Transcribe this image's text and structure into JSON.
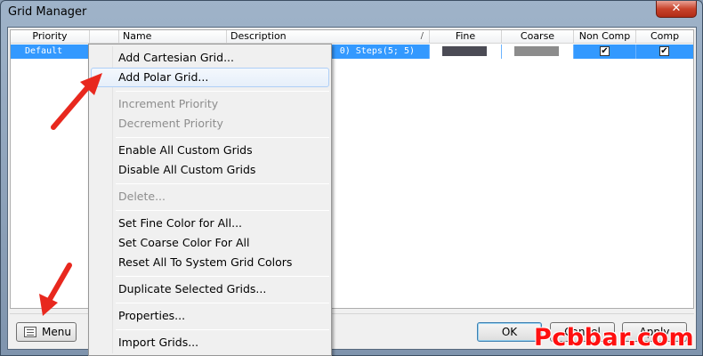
{
  "window": {
    "title": "Grid Manager",
    "close_label": "✕"
  },
  "grid": {
    "columns": [
      "Priority",
      "Name",
      "Description",
      "Fine",
      "Coarse",
      "Non Comp",
      "Comp"
    ],
    "sort_indicator": "/",
    "row": {
      "priority": "Default",
      "description": "0) Steps(5; 5)",
      "fine_color": "#4b4b55",
      "coarse_color": "#8c8c8c",
      "non_comp_checked": "✔",
      "comp_checked": "✔"
    }
  },
  "context_menu": {
    "items": [
      {
        "label": "Add Cartesian Grid...",
        "enabled": true
      },
      {
        "label": "Add Polar Grid...",
        "enabled": true,
        "highlighted": true
      },
      {
        "label": "Increment Priority",
        "enabled": false
      },
      {
        "label": "Decrement Priority",
        "enabled": false
      },
      {
        "label": "Enable All Custom Grids",
        "enabled": true
      },
      {
        "label": "Disable All Custom Grids",
        "enabled": true
      },
      {
        "label": "Delete...",
        "enabled": false
      },
      {
        "label": "Set Fine Color for All...",
        "enabled": true
      },
      {
        "label": "Set Coarse Color For All",
        "enabled": true
      },
      {
        "label": "Reset All To System Grid Colors",
        "enabled": true
      },
      {
        "label": "Duplicate Selected Grids...",
        "enabled": true
      },
      {
        "label": "Properties...",
        "enabled": true
      },
      {
        "label": "Import Grids...",
        "enabled": true
      }
    ]
  },
  "buttons": {
    "menu": "Menu",
    "ok": "OK",
    "cancel": "Cancel",
    "apply": "Apply"
  },
  "annotation": {
    "arrow_color": "#e8281e"
  },
  "watermark": "Pcbbar.com"
}
